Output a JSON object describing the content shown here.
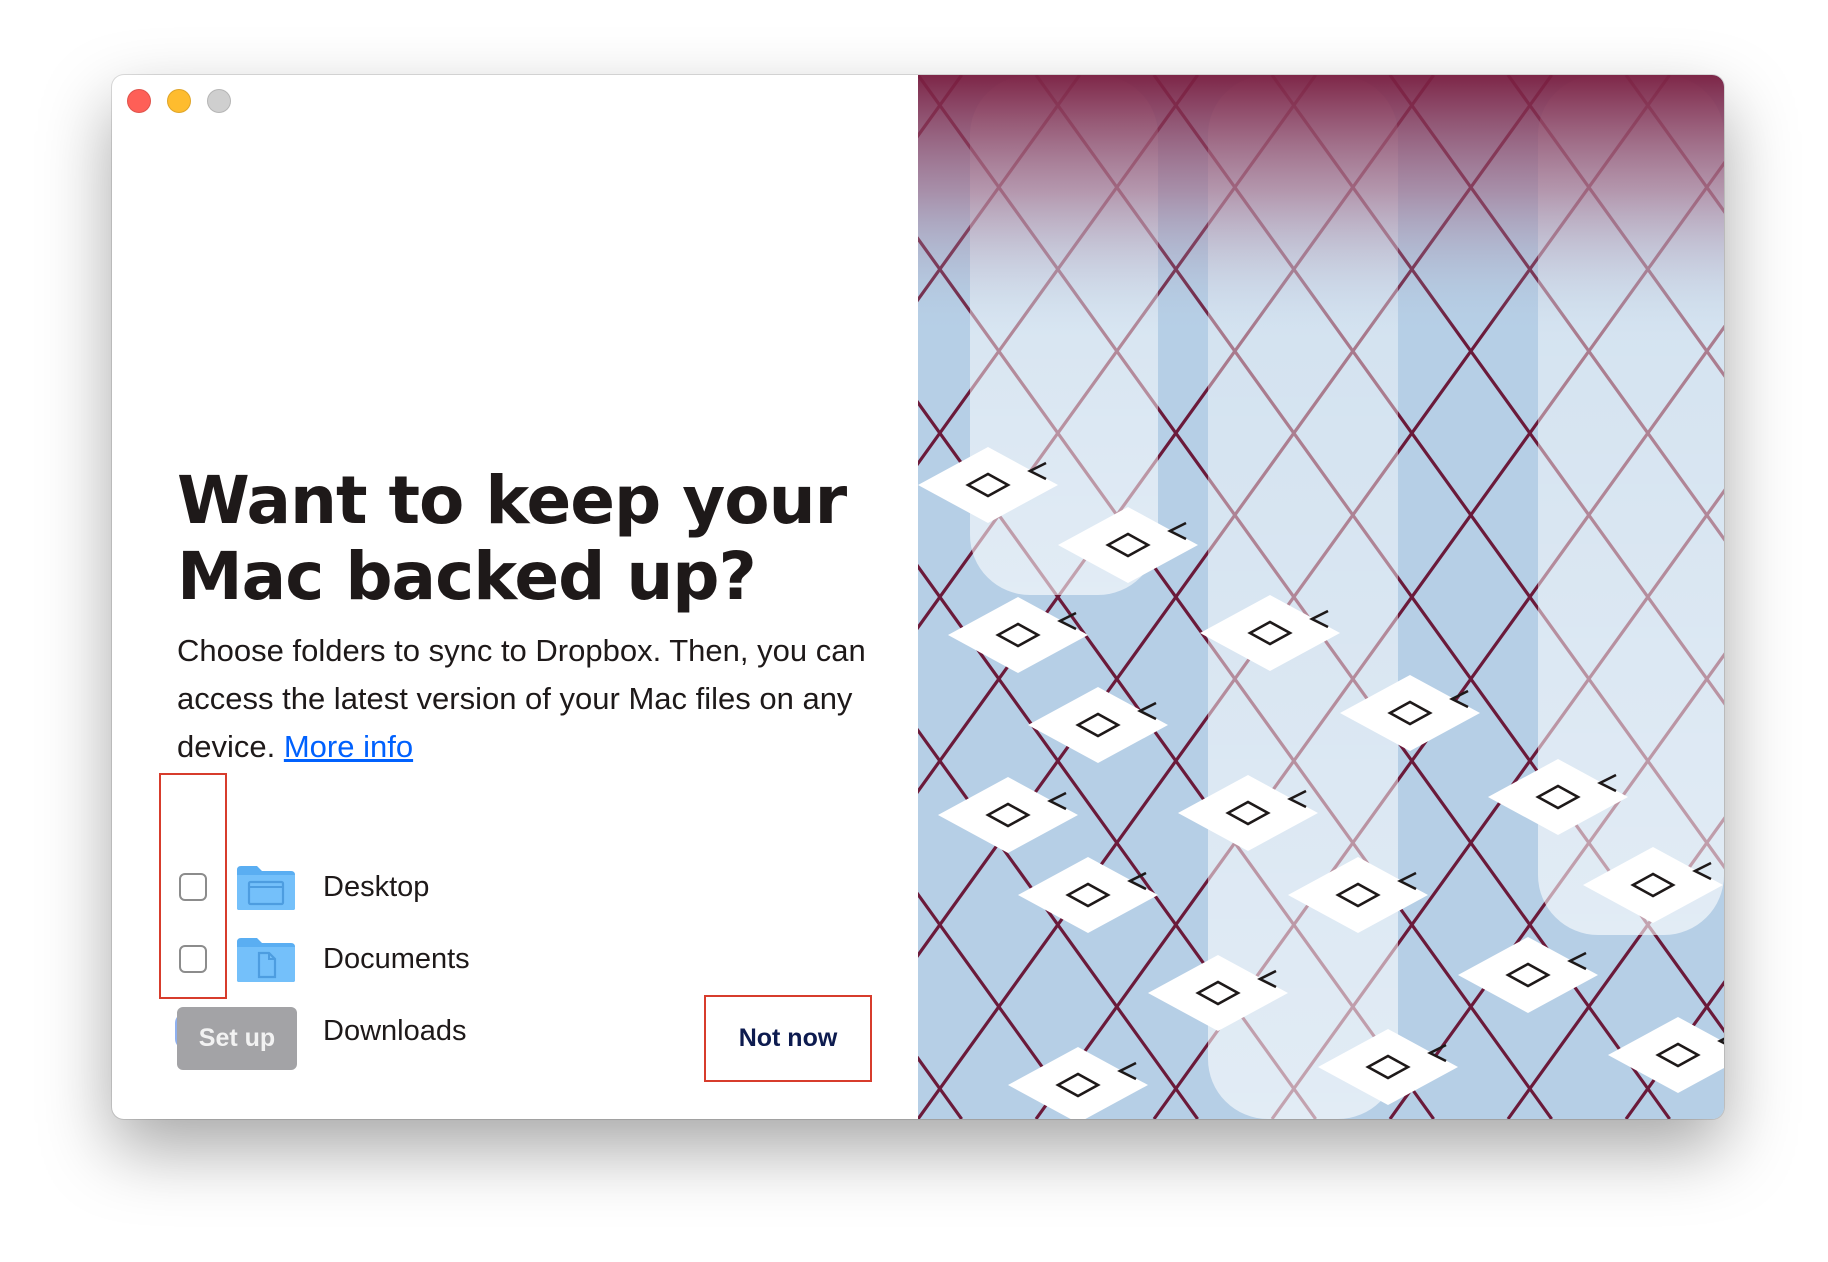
{
  "window": {
    "controls": [
      "close",
      "minimize",
      "zoom"
    ]
  },
  "content": {
    "headline": "Want to keep your Mac backed up?",
    "body": "Choose folders to sync to Dropbox. Then, you can access the latest version of your Mac files on any device.",
    "more_info_link": "More info"
  },
  "folders": [
    {
      "label": "Desktop",
      "checked": false,
      "icon": "desktop-folder-icon"
    },
    {
      "label": "Documents",
      "checked": false,
      "icon": "documents-folder-icon"
    },
    {
      "label": "Downloads",
      "checked": false,
      "focused": true,
      "icon": "downloads-folder-icon"
    }
  ],
  "buttons": {
    "setup": "Set up",
    "not_now": "Not now"
  },
  "colors": {
    "headline": "#1e1919",
    "link": "#0061fe",
    "setup_button_disabled": "#a3a3a6",
    "not_now_text": "#0d1b4f",
    "annotation_red": "#d73c2c",
    "illustration_bg": "#b6cfe6",
    "illustration_grid": "#6b1a3a"
  }
}
